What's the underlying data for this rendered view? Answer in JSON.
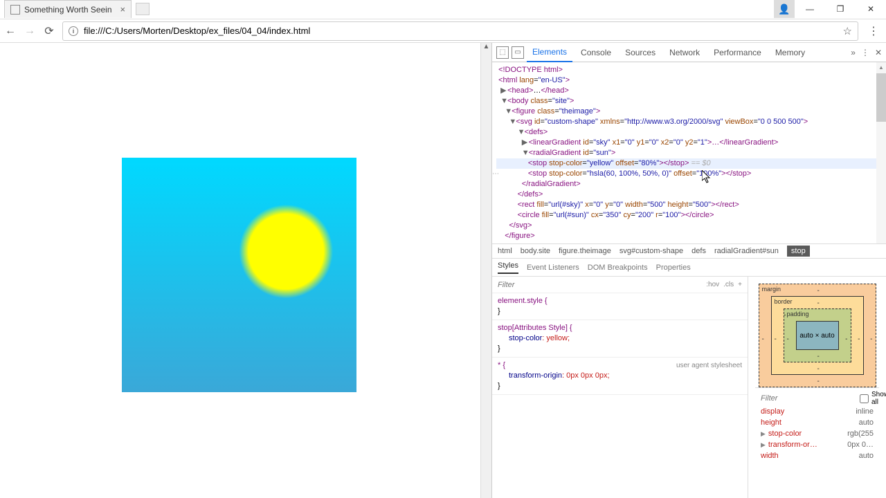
{
  "window": {
    "profile_icon": "👤",
    "min": "—",
    "max": "❐",
    "close": "✕"
  },
  "tab": {
    "title": "Something Worth Seein"
  },
  "url": "file:///C:/Users/Morten/Desktop/ex_files/04_04/index.html",
  "devtools": {
    "tabs": [
      "Elements",
      "Console",
      "Sources",
      "Network",
      "Performance",
      "Memory"
    ],
    "active_tab": "Elements",
    "more": "»",
    "menu": "⋮",
    "close": "✕"
  },
  "dom": {
    "l1": "<!DOCTYPE html>",
    "l2a": "<html",
    "l2b": " lang",
    "l2c": "\"en-US\"",
    "l2d": ">",
    "l3a": "<head>",
    "l3b": "…",
    "l3c": "</head>",
    "l4a": "<body",
    "l4b": " class",
    "l4c": "\"site\"",
    "l4d": ">",
    "l5a": "<figure",
    "l5b": " class",
    "l5c": "\"theimage\"",
    "l5d": ">",
    "l6a": "<svg",
    "l6b": " id",
    "l6c": "\"custom-shape\"",
    "l6d": " xmlns",
    "l6e": "\"http://www.w3.org/2000/svg\"",
    "l6f": " viewBox",
    "l6g": "\"0 0 500 500\"",
    "l6h": ">",
    "l7": "<defs>",
    "l8a": "<linearGradient",
    "l8b": " id",
    "l8c": "\"sky\"",
    "l8d": " x1",
    "l8e": "\"0\"",
    "l8f": " y1",
    "l8g": "\"0\"",
    "l8h": " x2",
    "l8i": "\"0\"",
    "l8j": " y2",
    "l8k": "\"1\"",
    "l8l": ">…</linearGradient>",
    "l9a": "<radialGradient",
    "l9b": " id",
    "l9c": "\"sun\"",
    "l9d": ">",
    "l10a": "<stop",
    "l10b": " stop-color",
    "l10c": "\"yellow\"",
    "l10d": " offset",
    "l10e": "\"80%\"",
    "l10f": "></stop>",
    "l10g": " == $0",
    "l11a": "<stop",
    "l11b": " stop-color",
    "l11c": "\"hsla(60, 100%, 50%, 0)\"",
    "l11d": " offset",
    "l11e": "\"100%\"",
    "l11f": "></stop>",
    "l12": "</radialGradient>",
    "l13": "</defs>",
    "l14a": "<rect",
    "l14b": " fill",
    "l14c": "\"url(#sky)\"",
    "l14d": " x",
    "l14e": "\"0\"",
    "l14f": " y",
    "l14g": "\"0\"",
    "l14h": " width",
    "l14i": "\"500\"",
    "l14j": " height",
    "l14k": "\"500\"",
    "l14l": "></rect>",
    "l15a": "<circle",
    "l15b": " fill",
    "l15c": "\"url(#sun)\"",
    "l15d": " cx",
    "l15e": "\"350\"",
    "l15f": " cy",
    "l15g": "\"200\"",
    "l15h": " r",
    "l15i": "\"100\"",
    "l15j": "></circle>",
    "l16": "</svg>",
    "l17": "</figure>"
  },
  "breadcrumb": [
    "html",
    "body.site",
    "figure.theimage",
    "svg#custom-shape",
    "defs",
    "radialGradient#sun",
    "stop"
  ],
  "style_tabs": [
    "Styles",
    "Event Listeners",
    "DOM Breakpoints",
    "Properties"
  ],
  "filter": {
    "placeholder": "Filter",
    "hov": ":hov",
    "cls": ".cls",
    "plus": "+"
  },
  "styles": {
    "b1_sel": "element.style {",
    "b1_end": "}",
    "b2_sel": "stop[Attributes Style] {",
    "b2_p1n": "stop-color",
    "b2_p1v": ": yellow;",
    "b2_end": "}",
    "b3_sel": "* {",
    "b3_ua": "user agent stylesheet",
    "b3_p1n": "transform-origin",
    "b3_p1v": ": 0px 0px 0px;",
    "b3_end": "}"
  },
  "boxmodel": {
    "margin": "margin",
    "border": "border",
    "padding": "padding",
    "content": "auto × auto",
    "dash": "-"
  },
  "computed": {
    "filter_placeholder": "Filter",
    "showall": "Show all",
    "rows": [
      {
        "n": "display",
        "v": "inline"
      },
      {
        "n": "height",
        "v": "auto"
      },
      {
        "n": "stop-color",
        "v": "rgb(255"
      },
      {
        "n": "transform-or…",
        "v": "0px 0…"
      },
      {
        "n": "width",
        "v": "auto"
      }
    ]
  }
}
